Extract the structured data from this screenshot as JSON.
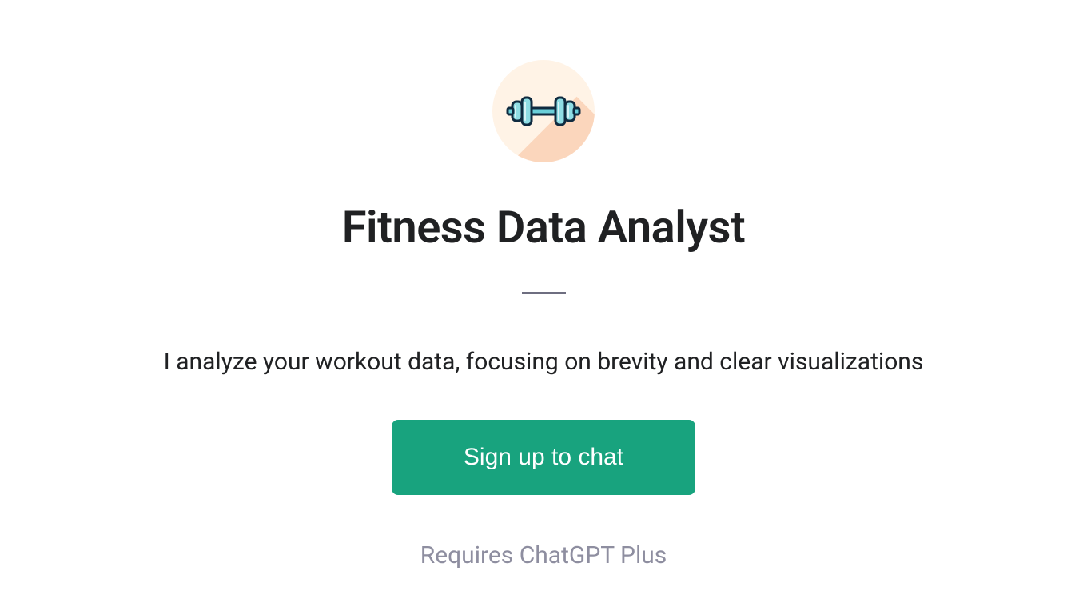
{
  "profile": {
    "title": "Fitness Data Analyst",
    "description": "I analyze your workout data, focusing on brevity and clear visualizations"
  },
  "cta": {
    "button_label": "Sign up to chat",
    "requirement_text": "Requires ChatGPT Plus"
  }
}
